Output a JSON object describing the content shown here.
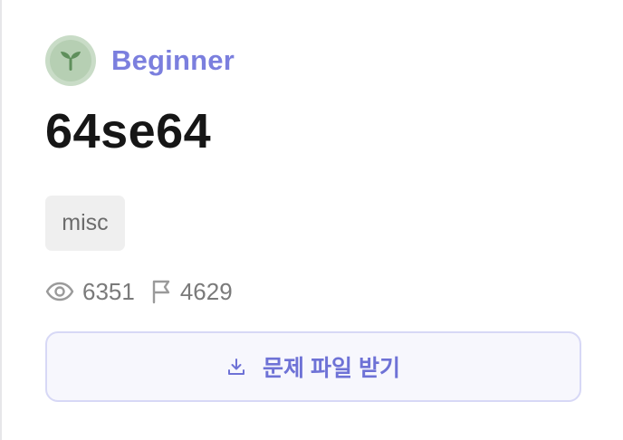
{
  "challenge": {
    "level": {
      "label": "Beginner",
      "icon": "sprout-icon",
      "color": "#7b7fde"
    },
    "title": "64se64",
    "tags": [
      "misc"
    ],
    "stats": {
      "views": "6351",
      "views_icon": "eye-icon",
      "solves": "4629",
      "solves_icon": "flag-icon"
    },
    "download": {
      "label": "문제 파일 받기",
      "icon": "download-icon"
    }
  }
}
